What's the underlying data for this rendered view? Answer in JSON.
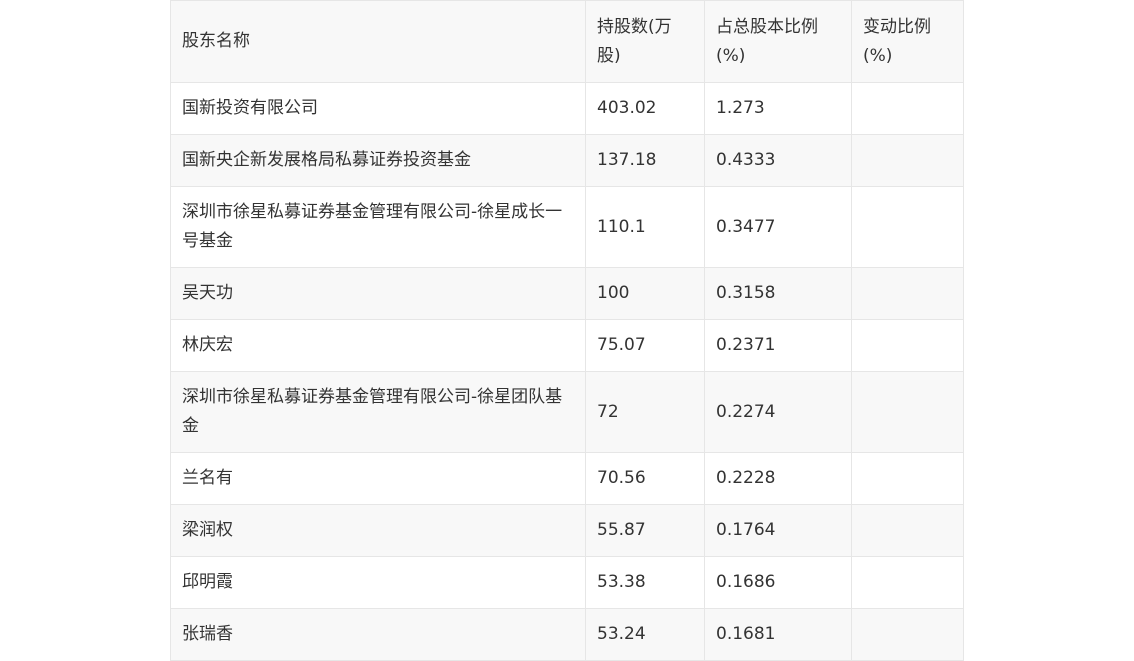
{
  "table": {
    "headers": [
      "股东名称",
      "持股数(万股)",
      "占总股本比例(%)",
      "变动比例(%)"
    ],
    "rows": [
      [
        "国新投资有限公司",
        "403.02",
        "1.273",
        ""
      ],
      [
        "国新央企新发展格局私募证券投资基金",
        "137.18",
        "0.4333",
        ""
      ],
      [
        "深圳市徐星私募证券基金管理有限公司-徐星成长一号基金",
        "110.1",
        "0.3477",
        ""
      ],
      [
        "吴天功",
        "100",
        "0.3158",
        ""
      ],
      [
        "林庆宏",
        "75.07",
        "0.2371",
        ""
      ],
      [
        "深圳市徐星私募证券基金管理有限公司-徐星团队基金",
        "72",
        "0.2274",
        ""
      ],
      [
        "兰名有",
        "70.56",
        "0.2228",
        ""
      ],
      [
        "梁润权",
        "55.87",
        "0.1764",
        ""
      ],
      [
        "邱明霞",
        "53.38",
        "0.1686",
        ""
      ],
      [
        "张瑞香",
        "53.24",
        "0.1681",
        ""
      ]
    ]
  }
}
